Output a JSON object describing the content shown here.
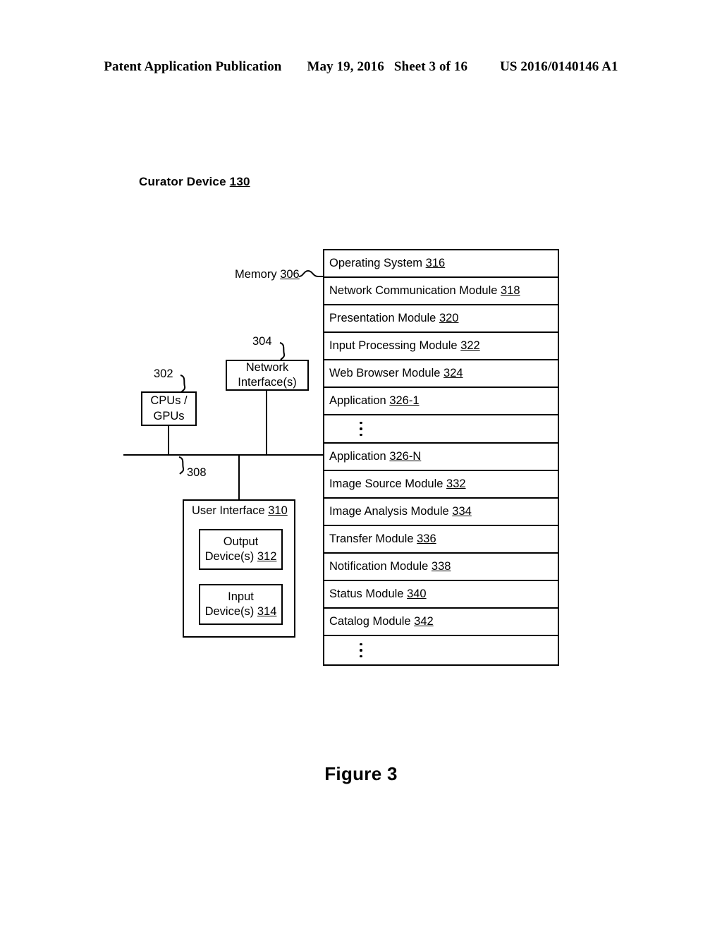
{
  "header": {
    "publication": "Patent Application Publication",
    "date": "May 19, 2016",
    "sheet": "Sheet 3 of 16",
    "patent_number": "US 2016/0140146 A1"
  },
  "figure": {
    "title_text": "Curator Device",
    "title_ref": "130",
    "caption": "Figure 3"
  },
  "memory": {
    "label": "Memory",
    "ref": "306",
    "rows": [
      {
        "label": "Operating System",
        "ref": "316"
      },
      {
        "label": "Network Communication Module",
        "ref": "318"
      },
      {
        "label": "Presentation Module",
        "ref": "320"
      },
      {
        "label": "Input Processing Module",
        "ref": "322"
      },
      {
        "label": "Web Browser Module",
        "ref": "324"
      },
      {
        "label": "Application",
        "ref": "326-1"
      },
      {
        "label": "",
        "ref": "",
        "ellipsis": true
      },
      {
        "label": "Application",
        "ref": "326-N"
      },
      {
        "label": "Image Source Module",
        "ref": "332"
      },
      {
        "label": "Image Analysis Module",
        "ref": "334"
      },
      {
        "label": "Transfer Module",
        "ref": "336"
      },
      {
        "label": "Notification Module",
        "ref": "338"
      },
      {
        "label": "Status Module",
        "ref": "340"
      },
      {
        "label": "Catalog Module",
        "ref": "342"
      },
      {
        "label": "",
        "ref": "",
        "ellipsis": true
      }
    ]
  },
  "cpu_block": {
    "line1": "CPUs /",
    "line2": "GPUs",
    "ref": "302"
  },
  "network_block": {
    "line1": "Network",
    "line2": "Interface(s)",
    "ref": "304"
  },
  "bus": {
    "ref": "308"
  },
  "user_interface": {
    "label": "User Interface",
    "ref": "310",
    "output": {
      "line1": "Output",
      "line2": "Device(s)",
      "ref": "312"
    },
    "input": {
      "line1": "Input",
      "line2": "Device(s)",
      "ref": "314"
    }
  }
}
